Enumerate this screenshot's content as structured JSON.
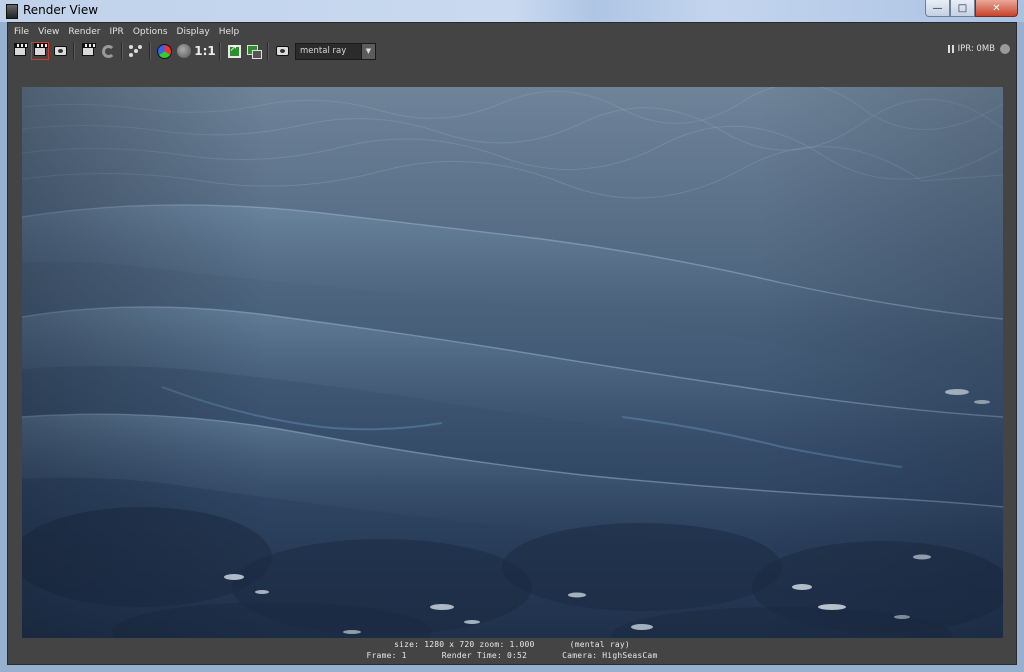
{
  "window": {
    "title": "Render View",
    "controls": {
      "minimize": "—",
      "maximize": "□",
      "close": "✕"
    }
  },
  "menu": [
    "File",
    "View",
    "Render",
    "IPR",
    "Options",
    "Display",
    "Help"
  ],
  "toolbar": {
    "icons": [
      "render-current-frame-icon",
      "render-region-icon",
      "snapshot-icon",
      "ipr-render-icon",
      "refresh-ipr-icon",
      "render-sequence-icon",
      "rgb-channels-icon",
      "alpha-channel-icon",
      "keep-image-icon",
      "compare-images-icon",
      "render-settings-icon"
    ],
    "real_size_label": "1:1",
    "renderer": "mental ray",
    "ipr_memory": "IPR: 0MB"
  },
  "status": {
    "line1": "size: 1280 x 720 zoom: 1.000       (mental ray)",
    "line2": "Frame: 1       Render Time: 0:52       Camera: HighSeasCam"
  },
  "colors": {
    "panel_bg": "#444444",
    "water_deep": "#243650",
    "water_far": "#6d8399",
    "highlight": "#d7e3ef"
  }
}
